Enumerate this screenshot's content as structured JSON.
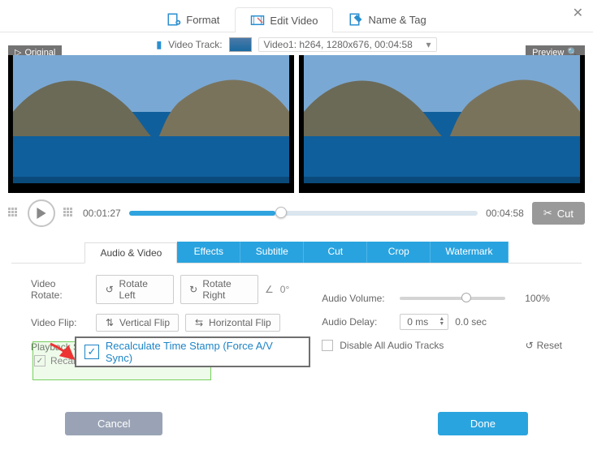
{
  "top_tabs": {
    "format": "Format",
    "edit_video": "Edit Video",
    "name_tag": "Name & Tag"
  },
  "close_glyph": "✕",
  "track": {
    "label": "Video Track:",
    "info": "Video1: h264, 1280x676, 00:04:58"
  },
  "badges": {
    "original": "Original",
    "preview": "Preview"
  },
  "playbar": {
    "current": "00:01:27",
    "total": "00:04:58",
    "cut": "Cut"
  },
  "subtabs": {
    "audio_video": "Audio & Video",
    "effects": "Effects",
    "subtitle": "Subtitle",
    "cut": "Cut",
    "crop": "Crop",
    "watermark": "Watermark"
  },
  "opts": {
    "rotate_label": "Video Rotate:",
    "rotate_left": "Rotate Left",
    "rotate_right": "Rotate Right",
    "angle": "0°",
    "flip_label": "Video Flip:",
    "vflip": "Vertical Flip",
    "hflip": "Horizontal Flip",
    "playback_label": "Playback Sp",
    "recalcu_partial": "Recalcu",
    "volume_label": "Audio Volume:",
    "volume_value": "100%",
    "delay_label": "Audio Delay:",
    "delay_box": "0 ms",
    "delay_sec": "0.0 sec",
    "disable_audio": "Disable All Audio Tracks",
    "reset": "Reset"
  },
  "overlay_text": "Recalculate Time Stamp (Force A/V Sync)",
  "footer": {
    "cancel": "Cancel",
    "done": "Done"
  },
  "angle_glyph": "∠"
}
